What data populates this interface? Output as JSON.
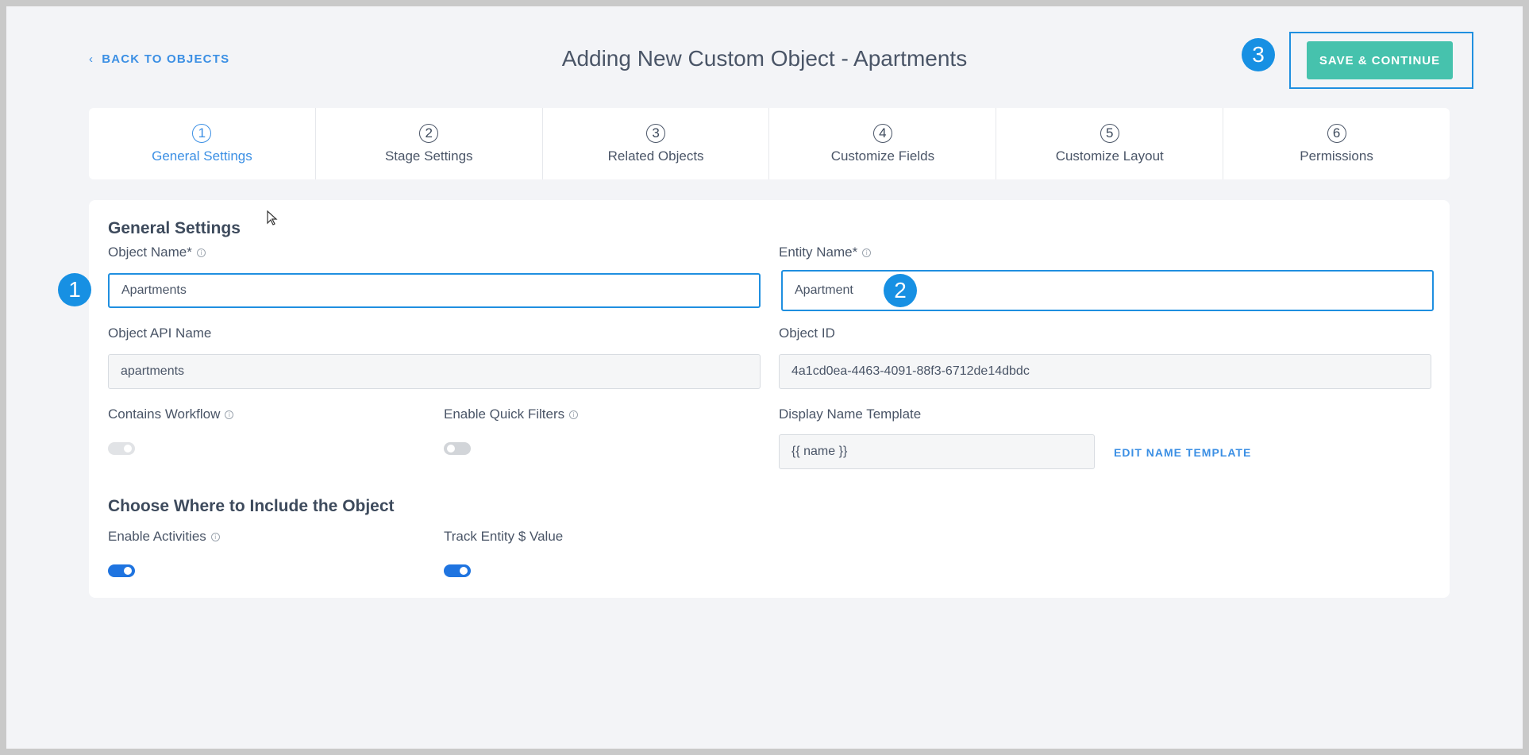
{
  "header": {
    "back_label": "BACK TO OBJECTS",
    "title": "Adding New Custom Object - Apartments",
    "save_label": "SAVE & CONTINUE"
  },
  "badges": [
    "1",
    "2",
    "3"
  ],
  "steps": [
    {
      "num": "1",
      "label": "General Settings",
      "active": true
    },
    {
      "num": "2",
      "label": "Stage Settings"
    },
    {
      "num": "3",
      "label": "Related Objects"
    },
    {
      "num": "4",
      "label": "Customize Fields"
    },
    {
      "num": "5",
      "label": "Customize Layout"
    },
    {
      "num": "6",
      "label": "Permissions"
    }
  ],
  "general": {
    "heading": "General Settings",
    "object_name_label": "Object Name*",
    "object_name_value": "Apartments",
    "entity_name_label": "Entity Name*",
    "entity_name_value": "Apartment",
    "api_name_label": "Object API Name",
    "api_name_value": "apartments",
    "object_id_label": "Object ID",
    "object_id_value": "4a1cd0ea-4463-4091-88f3-6712de14dbdc",
    "contains_workflow_label": "Contains Workflow",
    "contains_workflow_on": false,
    "quick_filters_label": "Enable Quick Filters",
    "quick_filters_on": false,
    "display_template_label": "Display Name Template",
    "display_template_value": "{{ name }}",
    "edit_template_label": "EDIT NAME TEMPLATE"
  },
  "include": {
    "heading": "Choose Where to Include the Object",
    "activities_label": "Enable Activities",
    "activities_on": true,
    "track_value_label": "Track Entity $ Value",
    "track_value_on": true
  },
  "colors": {
    "accent": "#3b8fe4",
    "save_button": "#46c2ad",
    "badge": "#1790e3",
    "toggle_on": "#1f74e0"
  }
}
